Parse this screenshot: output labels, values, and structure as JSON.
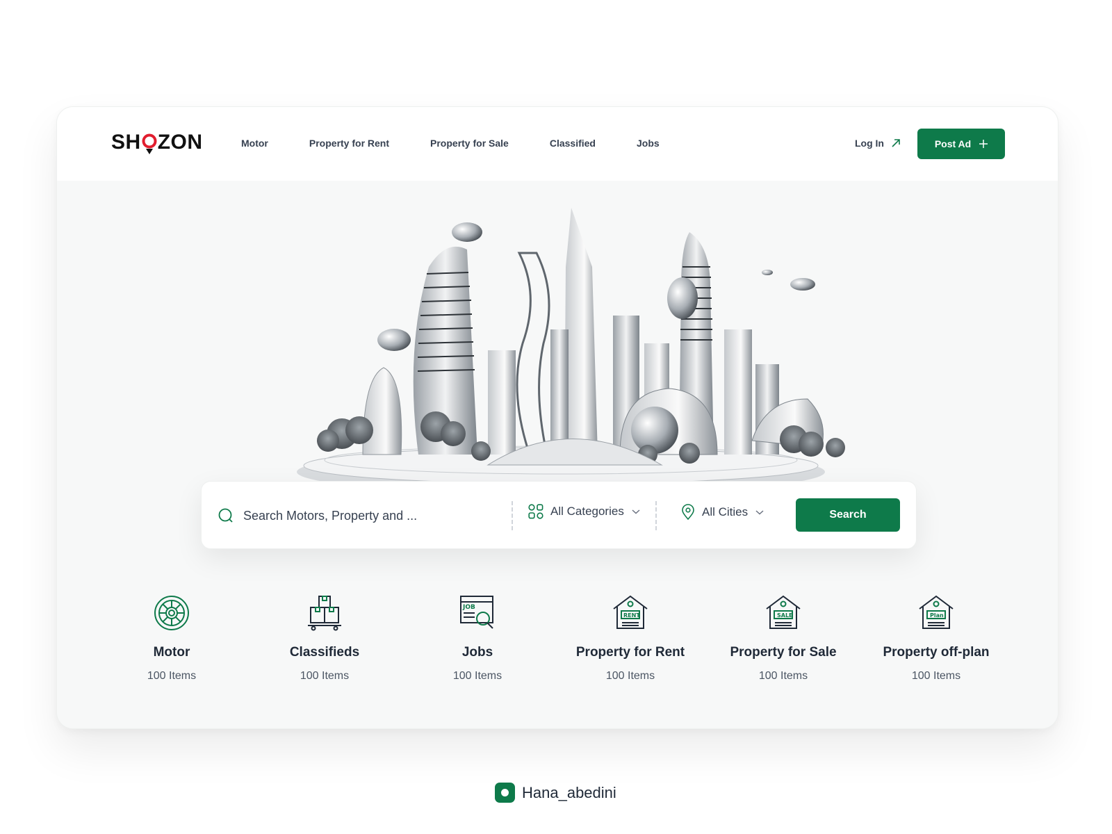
{
  "brand": {
    "name_left": "SH",
    "name_right": "ZON",
    "accent": "#0e7a4a",
    "pin_color": "#e11d2e"
  },
  "nav": {
    "items": [
      {
        "label": "Motor"
      },
      {
        "label": "Property for Rent"
      },
      {
        "label": "Property for Sale"
      },
      {
        "label": "Classified"
      },
      {
        "label": "Jobs"
      }
    ],
    "login_label": "Log In",
    "post_ad_label": "Post Ad"
  },
  "search": {
    "placeholder": "Search Motors, Property and ...",
    "category_value": "All Categories",
    "city_value": "All Cities",
    "button_label": "Search"
  },
  "categories": [
    {
      "title": "Motor",
      "count": "100 Items",
      "icon": "wheel-icon"
    },
    {
      "title": "Classifieds",
      "count": "100 Items",
      "icon": "boxes-icon"
    },
    {
      "title": "Jobs",
      "count": "100 Items",
      "icon": "job-search-icon"
    },
    {
      "title": "Property for Rent",
      "count": "100 Items",
      "icon": "house-rent-icon",
      "sign": "RENT"
    },
    {
      "title": "Property for Sale",
      "count": "100 Items",
      "icon": "house-sale-icon",
      "sign": "SALE"
    },
    {
      "title": "Property off-plan",
      "count": "100 Items",
      "icon": "house-plan-icon",
      "sign": "Plan"
    }
  ],
  "job_icon_label": "JOB",
  "credit": {
    "handle": "Hana_abedini",
    "icon": "instagram-icon"
  }
}
